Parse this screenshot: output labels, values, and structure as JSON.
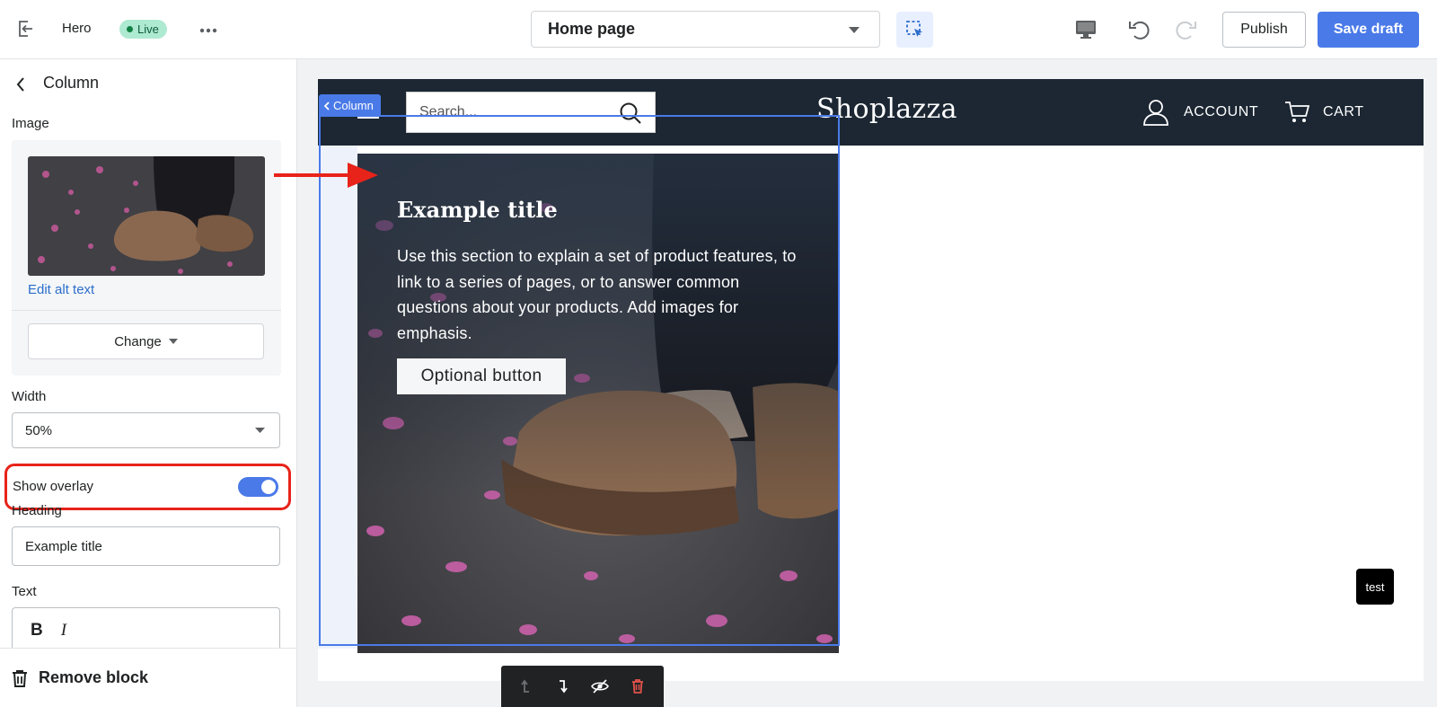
{
  "topbar": {
    "section_name": "Hero",
    "live_badge": "Live",
    "page_selector": "Home page",
    "publish_label": "Publish",
    "save_draft_label": "Save draft"
  },
  "sidebar": {
    "title": "Column",
    "image_label": "Image",
    "edit_alt_text": "Edit alt text",
    "change_label": "Change",
    "width_label": "Width",
    "width_value": "50%",
    "show_overlay_label": "Show overlay",
    "show_overlay_on": true,
    "heading_label": "Heading",
    "heading_value": "Example title",
    "text_label": "Text",
    "remove_block_label": "Remove block"
  },
  "preview": {
    "search_placeholder": "Search...",
    "store_name": "Shoplazza",
    "account_label": "ACCOUNT",
    "cart_label": "CART",
    "column_tag": "Column",
    "hero_title": "Example title",
    "hero_text": "Use this section to explain a set of product features, to link to a series of pages, or to answer common questions about your products. Add images for emphasis.",
    "hero_button": "Optional button",
    "floating_badge": "test"
  },
  "colors": {
    "accent": "#4a7ae8",
    "live_badge_bg": "#aee9d1",
    "store_header_bg": "#1c2733",
    "annotation_red": "#e8231a"
  }
}
